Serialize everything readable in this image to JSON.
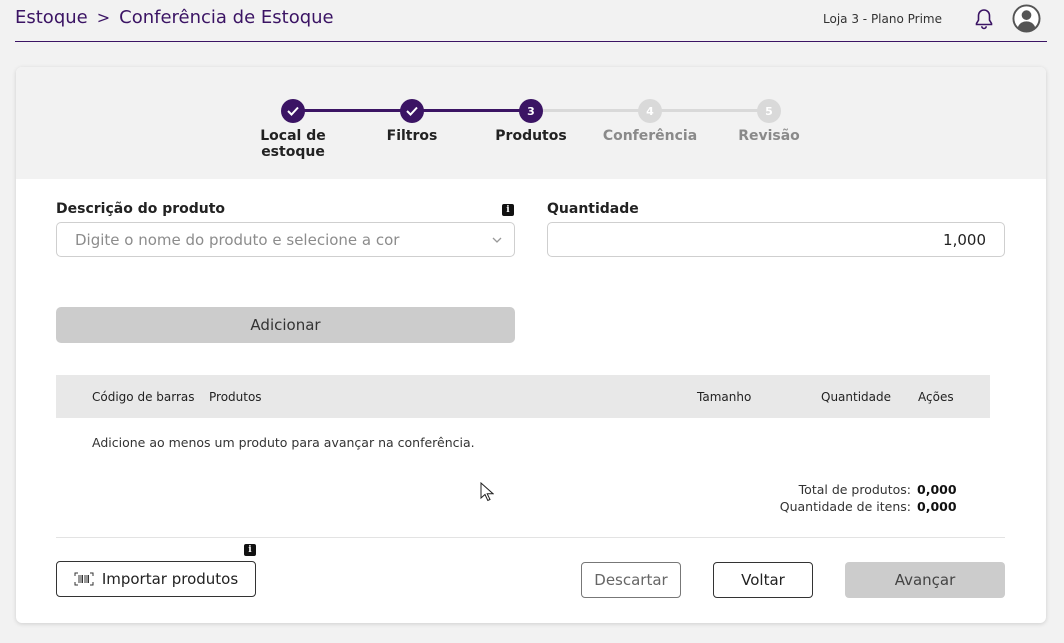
{
  "header": {
    "breadcrumb_root": "Estoque",
    "breadcrumb_separator": ">",
    "breadcrumb_current": "Conferência de Estoque",
    "store_label": "Loja 3 - Plano Prime"
  },
  "stepper": {
    "steps": [
      {
        "number": "1",
        "label": "Local de estoque",
        "state": "done"
      },
      {
        "number": "2",
        "label": "Filtros",
        "state": "done"
      },
      {
        "number": "3",
        "label": "Produtos",
        "state": "active"
      },
      {
        "number": "4",
        "label": "Conferência",
        "state": "todo"
      },
      {
        "number": "5",
        "label": "Revisão",
        "state": "todo"
      }
    ]
  },
  "form": {
    "description_label": "Descrição do produto",
    "description_placeholder": "Digite o nome do produto e selecione a cor",
    "quantity_label": "Quantidade",
    "quantity_value": "1,000",
    "add_button": "Adicionar"
  },
  "table": {
    "columns": [
      "Código de barras",
      "Produtos",
      "Tamanho",
      "Quantidade",
      "Ações"
    ],
    "empty_message": "Adicione ao menos um produto para avançar na conferência."
  },
  "totals": {
    "products_label": "Total de produtos:",
    "products_value": "0,000",
    "items_label": "Quantidade de itens:",
    "items_value": "0,000"
  },
  "footer": {
    "import_button": "Importar produtos",
    "discard_button": "Descartar",
    "back_button": "Voltar",
    "next_button": "Avançar"
  },
  "colors": {
    "brand": "#3b1464",
    "disabled": "#cccccc",
    "step_inactive": "#d9d9d9"
  },
  "icons": [
    "bell-icon",
    "user-avatar-icon",
    "check-icon",
    "info-icon",
    "chevron-down-icon",
    "barcode-icon"
  ]
}
